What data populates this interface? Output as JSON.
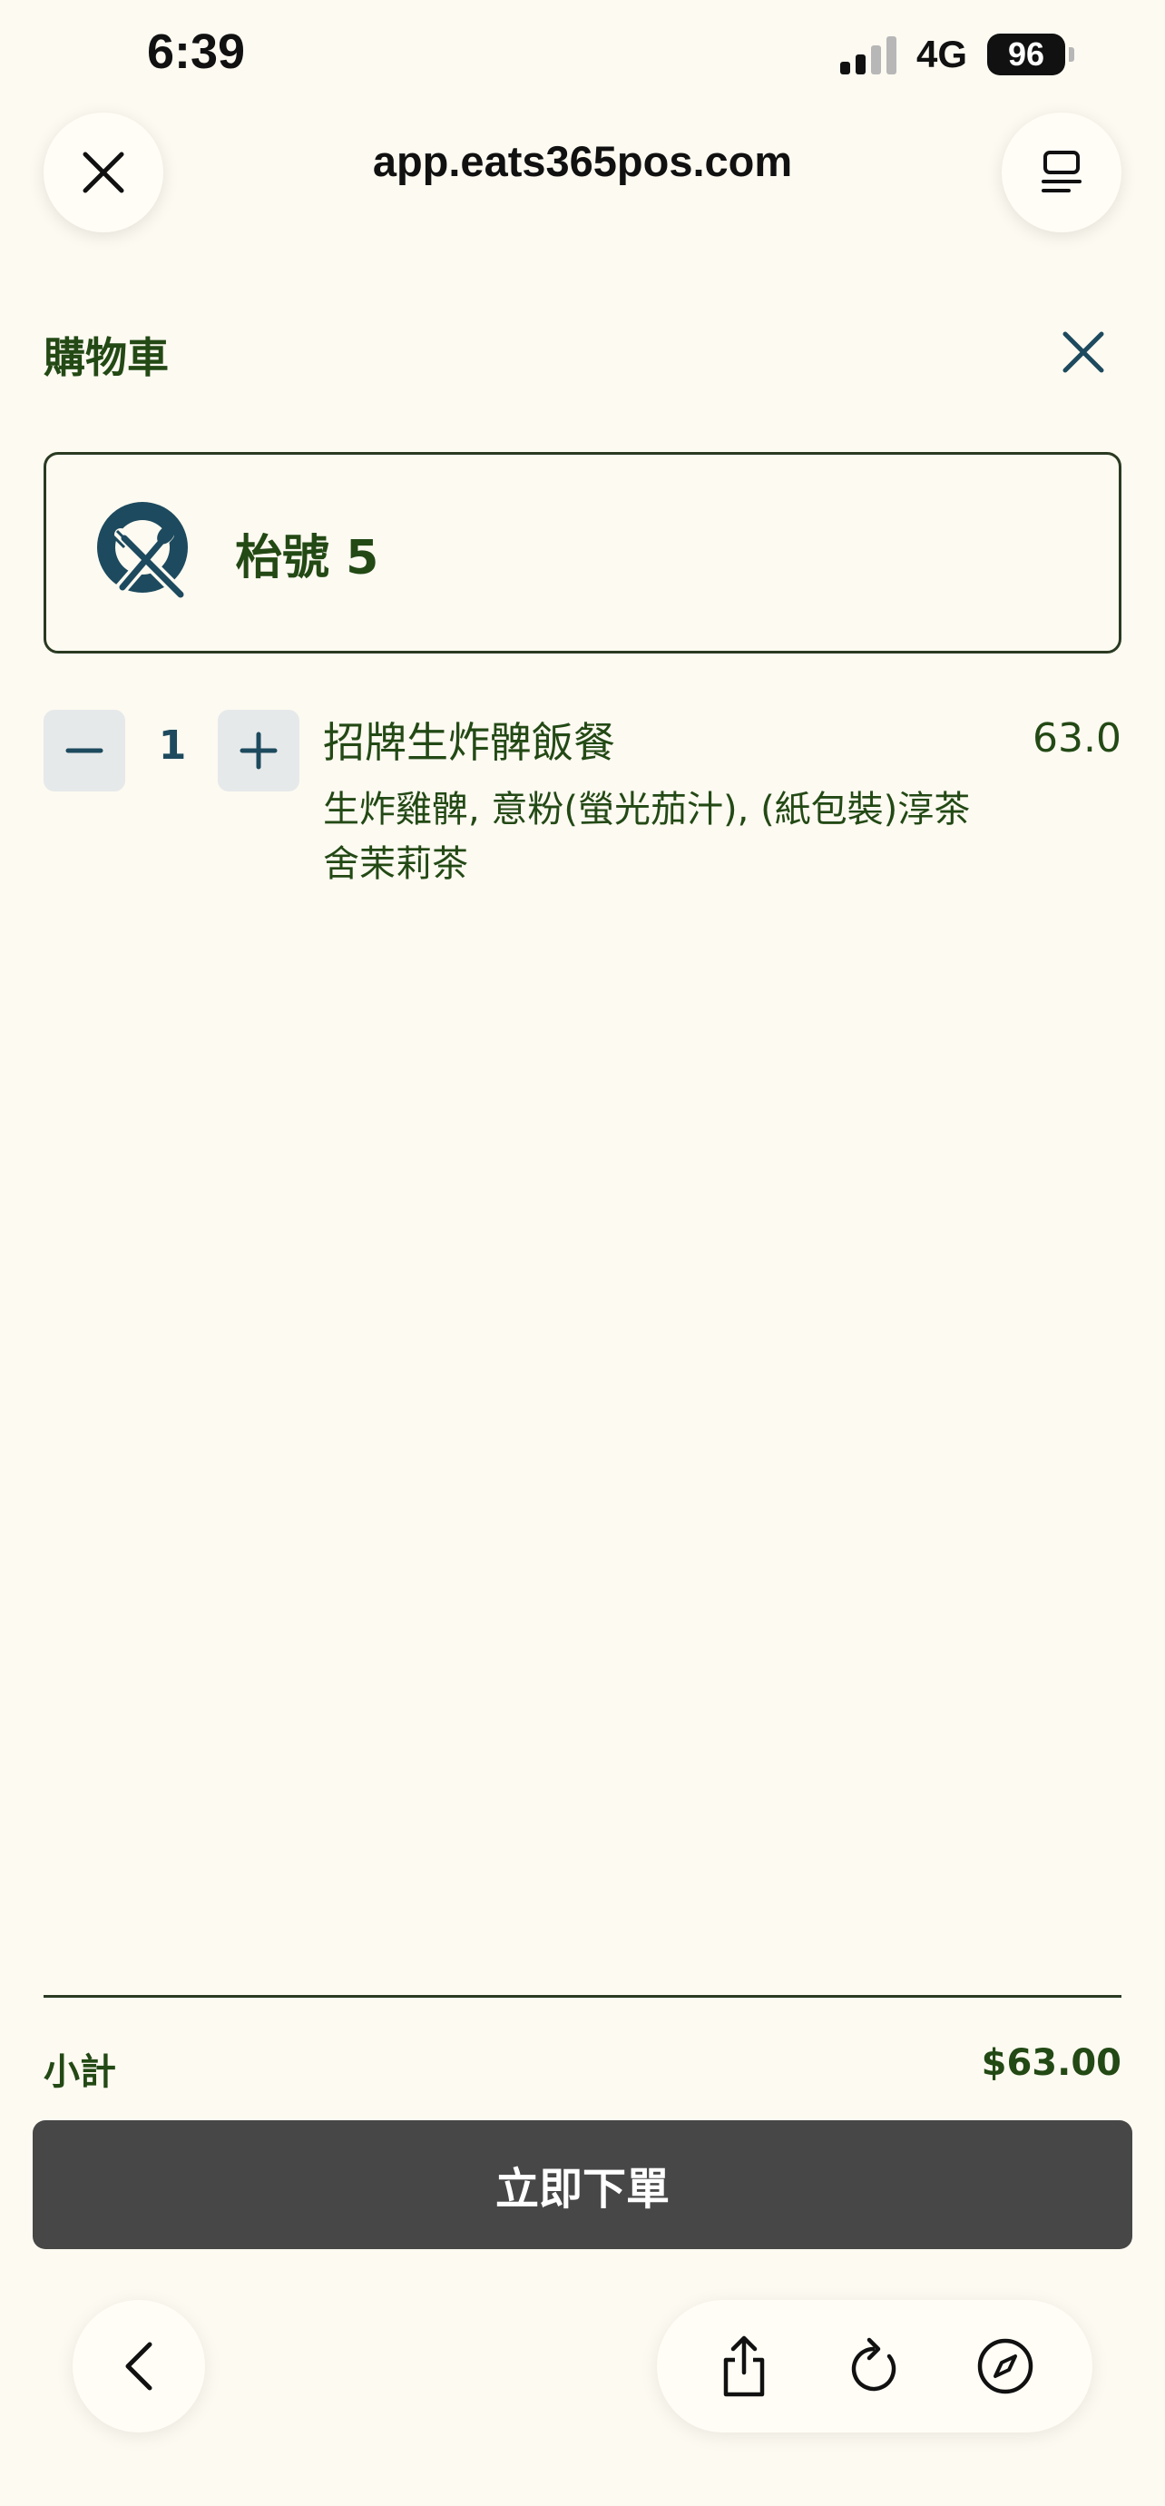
{
  "status_bar": {
    "time": "6:39",
    "network": "4G",
    "battery": "96"
  },
  "browser": {
    "url": "app.eats365pos.com"
  },
  "cart": {
    "title": "購物車",
    "table_label": "枱號 5",
    "items": [
      {
        "quantity": "1",
        "name": "招牌生炸髀飯餐",
        "price": "63.0",
        "description": "生炸雞髀, 意粉(螢光茄汁), (紙包裝)淳茶舍茉莉茶"
      }
    ],
    "subtotal_label": "小計",
    "subtotal_value": "$63.00",
    "order_button": "立即下單"
  },
  "colors": {
    "accent_green": "#234915",
    "accent_blue": "#1d4a5e",
    "button_dark": "#474747",
    "background": "#fdfaf1"
  }
}
